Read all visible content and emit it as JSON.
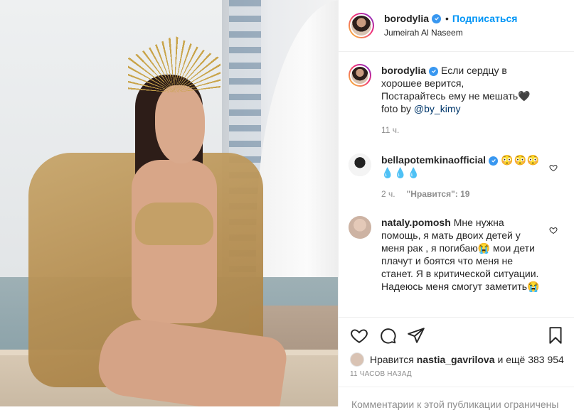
{
  "header": {
    "username": "borodylia",
    "separator": "•",
    "follow_label": "Подписаться",
    "location": "Jumeirah Al Naseem"
  },
  "caption": {
    "username": "borodylia",
    "text_before_mention": "Если сердцу в хорошее верится,\nПостарайтесь ему не мешать🖤 foto by ",
    "mention": "@by_kimy",
    "time": "11 ч."
  },
  "comments": [
    {
      "username": "bellapotemkinaofficial",
      "text": "😳😳😳 💧💧💧",
      "time": "2 ч.",
      "likes": "\"Нравится\": 19"
    },
    {
      "username": "nataly.pomosh",
      "text": "Мне нужна помощь, я мать двоих детей у меня рак , я погибаю😭 мои дети плачут и боятся что меня не станет. Я в критической ситуации. Надеюсь меня смогут заметить😭"
    }
  ],
  "likes": {
    "prefix": "Нравится",
    "user": "nastia_gavrilova",
    "suffix": "и ещё 383 954"
  },
  "timestamp": "11 часов назад",
  "comments_disabled": "Комментарии к этой публикации ограничены",
  "icons": {
    "verified": "verified-badge-icon",
    "like": "heart-icon",
    "comment": "comment-bubble-icon",
    "share": "paper-plane-icon",
    "save": "bookmark-icon"
  },
  "colors": {
    "accent": "#0095f6",
    "verified": "#3897f0",
    "muted": "#8e8e8e",
    "text": "#262626"
  }
}
